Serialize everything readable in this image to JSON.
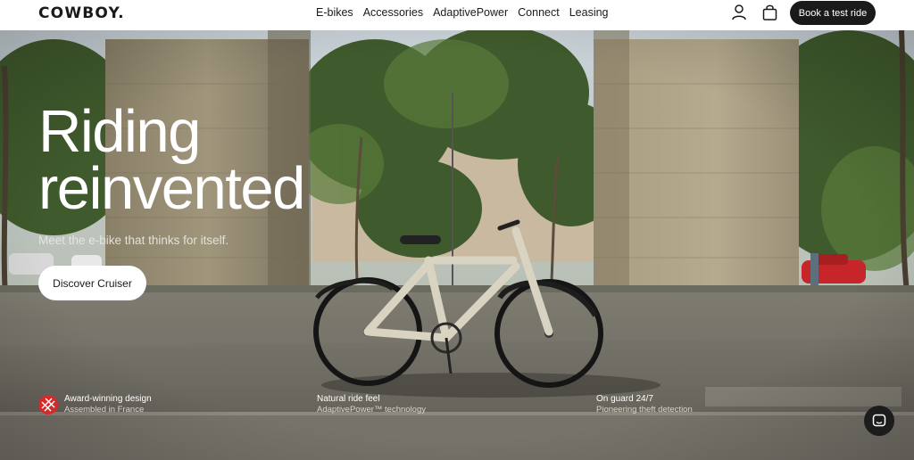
{
  "header": {
    "logo": "COWBOY.",
    "nav": [
      "E-bikes",
      "Accessories",
      "AdaptivePower",
      "Connect",
      "Leasing"
    ],
    "cta_label": "Book a test ride",
    "icons": [
      "user-icon",
      "bag-icon"
    ]
  },
  "hero": {
    "headline_line1": "Riding",
    "headline_line2": "reinvented",
    "subline": "Meet the e-bike that thinks for itself.",
    "cta_label": "Discover Cruiser"
  },
  "features": [
    {
      "title": "Award-winning design",
      "subtitle": "Assembled in France"
    },
    {
      "title": "Natural ride feel",
      "subtitle": "AdaptivePower™ technology"
    },
    {
      "title": "On guard 24/7",
      "subtitle": "Pioneering theft detection"
    }
  ],
  "colors": {
    "text_dark": "#1a1a1a",
    "button_dark": "#1a1a1a",
    "award_red": "#d42a2a"
  }
}
